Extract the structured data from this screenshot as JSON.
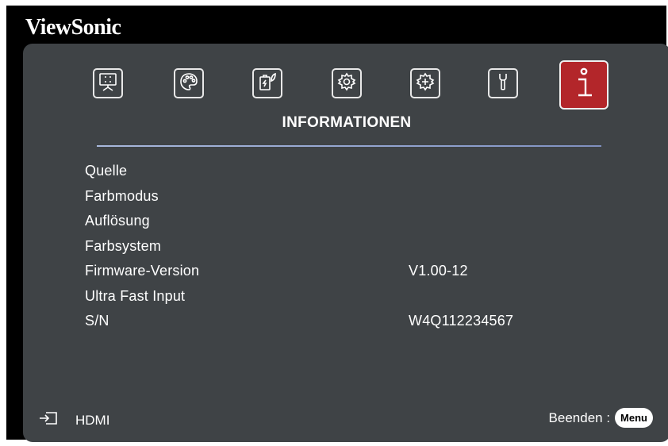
{
  "brand": "ViewSonic",
  "tabs": [
    {
      "icon": "projector-screen-icon",
      "active": false
    },
    {
      "icon": "palette-icon",
      "active": false
    },
    {
      "icon": "power-energy-icon",
      "active": false
    },
    {
      "icon": "basic-gear-icon",
      "active": false
    },
    {
      "icon": "advanced-gear-icon",
      "active": false
    },
    {
      "icon": "wrench-icon",
      "active": false
    },
    {
      "icon": "info-icon",
      "active": true
    }
  ],
  "section_title": "INFORMATIONEN",
  "info_rows": [
    {
      "label": "Quelle",
      "value": ""
    },
    {
      "label": "Farbmodus",
      "value": ""
    },
    {
      "label": "Auflösung",
      "value": ""
    },
    {
      "label": "Farbsystem",
      "value": ""
    },
    {
      "label": "Firmware-Version",
      "value": "V1.00-12"
    },
    {
      "label": "Ultra Fast Input",
      "value": ""
    },
    {
      "label": "S/N",
      "value": "W4Q112234567"
    }
  ],
  "footer": {
    "source_icon": "input-source-icon",
    "source_label": "HDMI",
    "exit_label": "Beenden :",
    "menu_button": "Menu"
  },
  "colors": {
    "panel_background": "#3f4346",
    "active_tab": "#b3262a",
    "divider": "#8a9ccb",
    "frame": "#000000"
  }
}
